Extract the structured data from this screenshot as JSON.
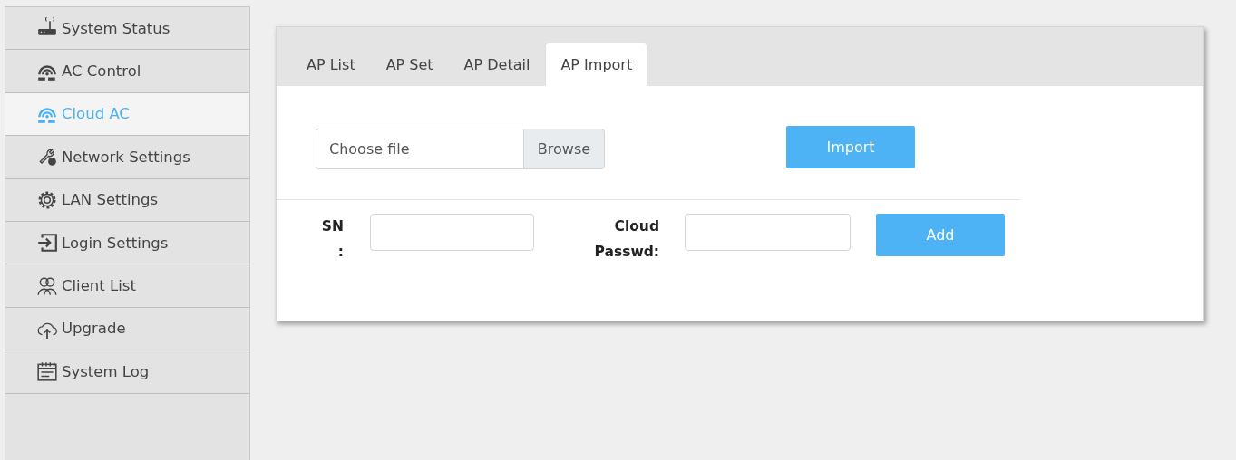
{
  "sidebar": {
    "items": [
      {
        "label": "System Status",
        "selected": false
      },
      {
        "label": "AC Control",
        "selected": false
      },
      {
        "label": "Cloud AC",
        "selected": true
      },
      {
        "label": "Network Settings",
        "selected": false
      },
      {
        "label": "LAN Settings",
        "selected": false
      },
      {
        "label": "Login Settings",
        "selected": false
      },
      {
        "label": "Client List",
        "selected": false
      },
      {
        "label": "Upgrade",
        "selected": false
      },
      {
        "label": "System Log",
        "selected": false
      }
    ]
  },
  "tabs": [
    {
      "label": "AP List",
      "selected": false
    },
    {
      "label": "AP Set",
      "selected": false
    },
    {
      "label": "AP Detail",
      "selected": false
    },
    {
      "label": "AP Import",
      "selected": true
    }
  ],
  "import_form": {
    "file_field": {
      "placeholder": "Choose file",
      "button": "Browse"
    },
    "import_button": "Import"
  },
  "add_form": {
    "sn_label": "SN :",
    "cloud_passwd_label": "Cloud Passwd:",
    "add_button": "Add"
  }
}
